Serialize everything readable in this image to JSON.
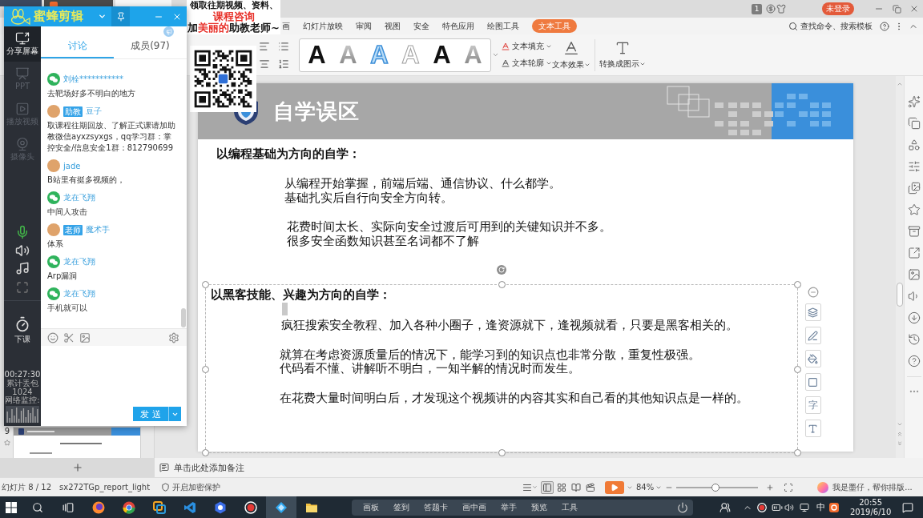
{
  "title_bar": {
    "tabs": [
      {
        "kind": "home",
        "selected": false
      },
      {
        "kind": "store",
        "selected": false
      },
      {
        "kind": "document",
        "selected": true
      }
    ],
    "page_badge": "1",
    "login_button": "未登录"
  },
  "ribbon_tabs": [
    {
      "label": "画",
      "selected": false
    },
    {
      "label": "幻灯片放映",
      "selected": false
    },
    {
      "label": "审阅",
      "selected": false
    },
    {
      "label": "视图",
      "selected": false
    },
    {
      "label": "安全",
      "selected": false
    },
    {
      "label": "特色应用",
      "selected": false
    },
    {
      "label": "绘图工具",
      "selected": false
    },
    {
      "label": "文本工具",
      "selected": true
    }
  ],
  "command_search": {
    "placeholder": "查找命令、搜索模板"
  },
  "ribbon": {
    "text_styles": [
      {
        "kind": "solid",
        "sample": "A"
      },
      {
        "kind": "gradient",
        "sample": "A"
      },
      {
        "kind": "outline-blue",
        "sample": "A"
      },
      {
        "kind": "outline",
        "sample": "A"
      },
      {
        "kind": "solid",
        "sample": "A"
      },
      {
        "kind": "gradient",
        "sample": "A"
      }
    ],
    "text_fill": "文本填充",
    "text_outline": "文本轮廓",
    "text_effect": "文本效果",
    "convert_to_diagram": "转换成图示"
  },
  "banner": {
    "lines": [
      [
        {
          "text": "领取往期视频、资料、",
          "highlight": false
        }
      ],
      [
        {
          "text": "课程咨询",
          "highlight": true
        }
      ],
      [
        {
          "text": "加",
          "highlight": false
        },
        {
          "text": "美丽的",
          "highlight": true
        },
        {
          "text": "助教老师~",
          "highlight": false
        }
      ]
    ]
  },
  "thumbnail": {
    "number": "9",
    "animated": true
  },
  "slide": {
    "title": "自学误区",
    "sections": [
      {
        "heading": "以编程基础为方向的自学：",
        "selected": false,
        "paragraphs": [
          [
            "从编程开始掌握，前端后端、通信协议、什么都学。",
            "基础扎实后自行向安全方向转。"
          ],
          [
            "花费时间太长、实际向安全过渡后可用到的关键知识并不多。",
            "很多安全函数知识甚至名词都不了解"
          ]
        ]
      },
      {
        "heading": "以黑客技能、兴趣为方向的自学：",
        "selected": true,
        "paragraphs": [
          [
            "疯狂搜索安全教程、加入各种小圈子，逢资源就下，逢视频就看，只要是黑客相关的。"
          ],
          [
            "就算在考虑资源质量后的情况下，能学习到的知识点也非常分散，重复性极强。",
            "代码看不懂、讲解听不明白，一知半解的情况时而发生。"
          ],
          [
            "在花费大量时间明白后，才发现这个视频讲的内容其实和自己看的其他知识点是一样的。"
          ]
        ]
      }
    ]
  },
  "float_toolbar": {
    "glyph": "字"
  },
  "notes": {
    "placeholder": "单击此处添加备注"
  },
  "status_bar": {
    "slide_indicator": "幻灯片 8 / 12",
    "theme_name": "sx272TGp_report_light",
    "encryption": "开启加密保护",
    "view_modes": [
      {
        "kind": "outline",
        "selected": false
      },
      {
        "kind": "normal",
        "selected": true
      },
      {
        "kind": "sorter",
        "selected": false
      },
      {
        "kind": "reading",
        "selected": false
      },
      {
        "kind": "record",
        "selected": false
      }
    ],
    "zoom": "84%",
    "zoom_slider": {
      "level": 0.48
    },
    "assistant": "我是墨仔，帮你排版..."
  },
  "chat": {
    "app_name": "蜜蜂剪辑",
    "sidebar": [
      {
        "label": "分享屏幕",
        "disabled": false
      },
      {
        "label": "PPT",
        "disabled": true
      },
      {
        "label": "播放视频",
        "disabled": true
      },
      {
        "label": "摄像头",
        "disabled": true
      }
    ],
    "mic_on": true,
    "end_class": "下课",
    "timer": "00:27:30",
    "stats": [
      "累计丢包",
      "1024",
      "网络监控:"
    ],
    "tabs": [
      {
        "label": "讨论",
        "selected": true
      },
      {
        "label": "成员(97)",
        "selected": false
      }
    ],
    "messages": [
      {
        "kind": "wechat",
        "name": "刘栓***********",
        "text": "去靶场好多不明白的地方"
      },
      {
        "kind": "photo",
        "badge": "助教",
        "name": "豆子",
        "text": "取课程往期回放、了解正式课请加助教微信ayxzsyxgs，qq学习群：掌控安全/信息安全1群：812790699"
      },
      {
        "kind": "photo",
        "name": "jade",
        "text": "B站里有挺多视频的，"
      },
      {
        "kind": "wechat",
        "name": "龙在飞翔",
        "text": "中间人攻击"
      },
      {
        "kind": "photo",
        "badge": "老师",
        "name": "魔术手",
        "text": "体系"
      },
      {
        "kind": "wechat",
        "name": "龙在飞翔",
        "text": "Arp漏洞"
      },
      {
        "kind": "wechat",
        "name": "龙在飞翔",
        "text": "手机就可以"
      }
    ],
    "send_button": "发 送"
  },
  "taskbar": {
    "apps": [
      {
        "kind": "fox",
        "active": false
      },
      {
        "kind": "ring",
        "active": false
      },
      {
        "kind": "squares",
        "active": false
      },
      {
        "kind": "code",
        "active": false
      },
      {
        "kind": "w-app",
        "active": false
      },
      {
        "kind": "record",
        "active": false
      },
      {
        "kind": "diamond",
        "active": true
      },
      {
        "kind": "folder",
        "active": false
      }
    ],
    "class_tools": [
      "画板",
      "签到",
      "答题卡",
      "画中画",
      "举手",
      "预览",
      "工具"
    ],
    "ime": "中",
    "time": "20:55",
    "date": "2019/6/10"
  }
}
